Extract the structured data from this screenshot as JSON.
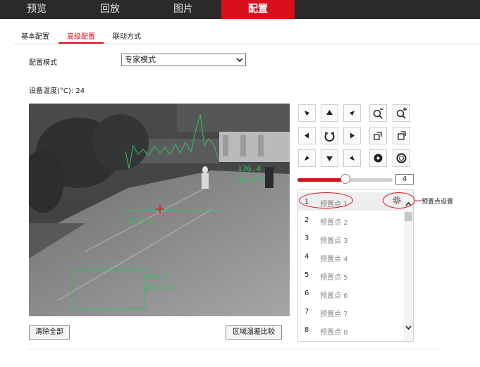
{
  "top_nav": {
    "tabs": [
      {
        "label": "预览"
      },
      {
        "label": "回放"
      },
      {
        "label": "图片"
      },
      {
        "label": "配置",
        "active": true
      }
    ]
  },
  "sub_nav": {
    "tabs": [
      {
        "label": "基本配置"
      },
      {
        "label": "高级配置",
        "active": true
      },
      {
        "label": "联动方式"
      }
    ]
  },
  "config_mode": {
    "label": "配置模式",
    "value": "专家模式"
  },
  "device_temp": {
    "label": "设备温度(°C): 24"
  },
  "video_overlay": {
    "line_max": "136.4",
    "line_avg": "30.4°C",
    "spot": "30.2°C",
    "box_max": "101.1",
    "box_avg": "29.1°C"
  },
  "ptz": {
    "speed": "4",
    "speed_level": 0.5
  },
  "presets": {
    "items": [
      {
        "num": "1",
        "name": "预置点 1"
      },
      {
        "num": "2",
        "name": "预置点 2"
      },
      {
        "num": "3",
        "name": "预置点 3"
      },
      {
        "num": "4",
        "name": "预置点 4"
      },
      {
        "num": "5",
        "name": "预置点 5"
      },
      {
        "num": "6",
        "name": "预置点 6"
      },
      {
        "num": "7",
        "name": "预置点 7"
      },
      {
        "num": "8",
        "name": "预置点 8"
      }
    ],
    "callout": "预置点设置"
  },
  "buttons": {
    "clear_all": "清除全部",
    "region_compare": "区域温差比较"
  },
  "colors": {
    "accent": "#d7101c",
    "overlay": "#33c15c"
  }
}
